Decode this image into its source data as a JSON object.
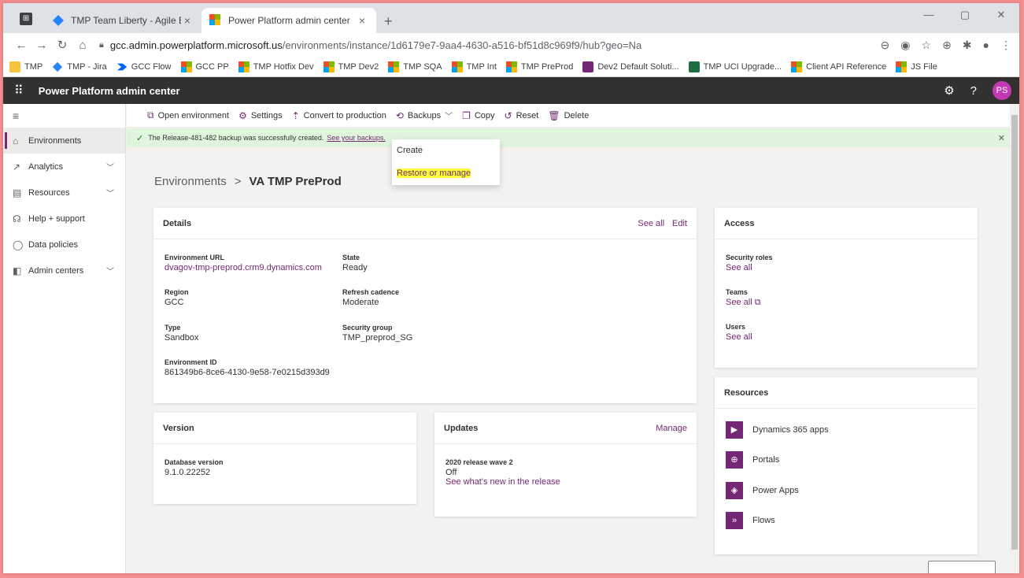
{
  "browser": {
    "tabs": [
      {
        "title": "TMP Team Liberty - Agile Board",
        "active": false
      },
      {
        "title": "Power Platform admin center",
        "active": true
      }
    ],
    "url_host": "gcc.admin.powerplatform.microsoft.us",
    "url_path": "/environments/instance/1d6179e7-9aa4-4630-a516-bf51d8c969f9/hub?geo=Na",
    "bookmarks": [
      "TMP",
      "TMP - Jira",
      "GCC Flow",
      "GCC PP",
      "TMP Hotfix Dev",
      "TMP Dev2",
      "TMP SQA",
      "TMP Int",
      "TMP PreProd",
      "Dev2 Default Soluti...",
      "TMP UCI Upgrade...",
      "Client API Reference",
      "JS File"
    ]
  },
  "app": {
    "title": "Power Platform admin center",
    "avatar_initials": "PS",
    "accent": "#742774"
  },
  "sidebar": {
    "items": [
      {
        "label": "Environments",
        "icon": "environments-icon",
        "selected": true
      },
      {
        "label": "Analytics",
        "icon": "analytics-icon"
      },
      {
        "label": "Resources",
        "icon": "resources-icon"
      },
      {
        "label": "Help + support",
        "icon": "help-icon"
      },
      {
        "label": "Data policies",
        "icon": "shield-icon"
      },
      {
        "label": "Admin centers",
        "icon": "admin-centers-icon"
      }
    ]
  },
  "commands": {
    "open_environment": "Open environment",
    "settings": "Settings",
    "convert": "Convert to production",
    "backups": "Backups",
    "copy": "Copy",
    "reset": "Reset",
    "delete": "Delete"
  },
  "banner": {
    "message": "The Release-481-482 backup was successfully created.",
    "link": "See your backups."
  },
  "backups_menu": {
    "create": "Create",
    "restore": "Restore or manage"
  },
  "breadcrumb": {
    "parent": "Environments",
    "separator": ">",
    "current": "VA TMP PreProd"
  },
  "details": {
    "title": "Details",
    "see_all": "See all",
    "edit": "Edit",
    "environment_url_label": "Environment URL",
    "environment_url": "dvagov-tmp-preprod.crm9.dynamics.com",
    "state_label": "State",
    "state": "Ready",
    "region_label": "Region",
    "region": "GCC",
    "refresh_label": "Refresh cadence",
    "refresh": "Moderate",
    "type_label": "Type",
    "type": "Sandbox",
    "security_group_label": "Security group",
    "security_group": "TMP_preprod_SG",
    "env_id_label": "Environment ID",
    "env_id": "861349b6-8ce6-4130-9e58-7e0215d393d9"
  },
  "access": {
    "title": "Access",
    "security_roles_label": "Security roles",
    "security_roles_link": "See all",
    "teams_label": "Teams",
    "teams_link": "See all",
    "users_label": "Users",
    "users_link": "See all"
  },
  "version": {
    "title": "Version",
    "db_label": "Database version",
    "db_value": "9.1.0.22252"
  },
  "updates": {
    "title": "Updates",
    "manage": "Manage",
    "wave_label": "2020 release wave 2",
    "wave_state": "Off",
    "whats_new": "See what's new in the release"
  },
  "resources": {
    "title": "Resources",
    "items": [
      "Dynamics 365 apps",
      "Portals",
      "Power Apps",
      "Flows"
    ]
  }
}
